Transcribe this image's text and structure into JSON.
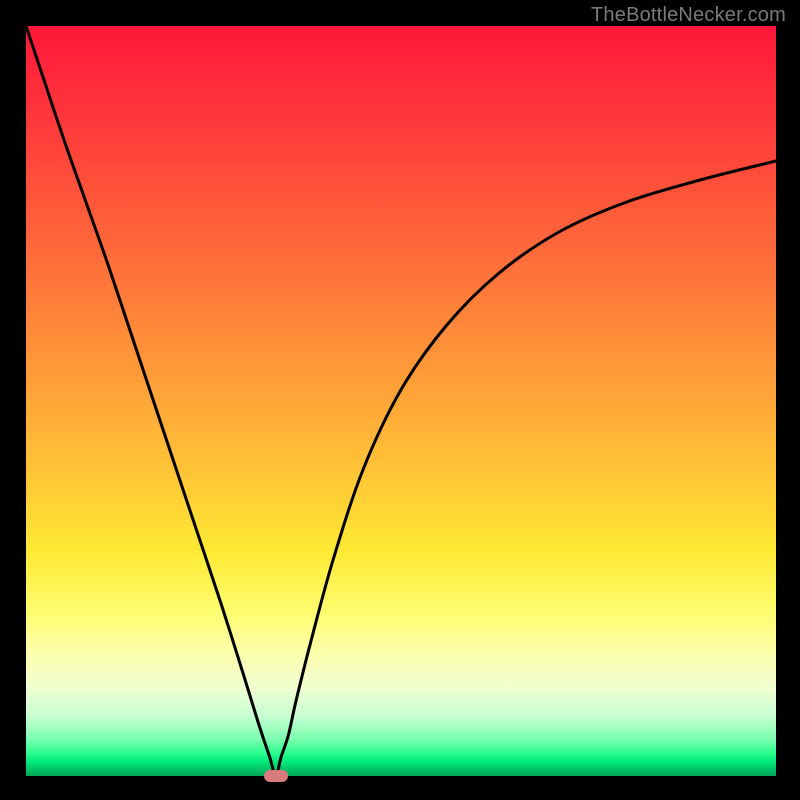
{
  "watermark": {
    "text": "TheBottleNecker.com"
  },
  "chart_data": {
    "type": "line",
    "title": "",
    "xlabel": "",
    "ylabel": "",
    "xlim": [
      0,
      100
    ],
    "ylim": [
      0,
      100
    ],
    "background_gradient": {
      "orientation": "vertical",
      "stops": [
        {
          "pos": 0,
          "color": "#ff173a"
        },
        {
          "pos": 0.14,
          "color": "#ff3c3b"
        },
        {
          "pos": 0.3,
          "color": "#ff6a3a"
        },
        {
          "pos": 0.46,
          "color": "#ff9a38"
        },
        {
          "pos": 0.6,
          "color": "#ffc636"
        },
        {
          "pos": 0.7,
          "color": "#ffe934"
        },
        {
          "pos": 0.78,
          "color": "#fffc6e"
        },
        {
          "pos": 0.84,
          "color": "#fcffb0"
        },
        {
          "pos": 0.88,
          "color": "#f2ffd0"
        },
        {
          "pos": 0.92,
          "color": "#c8ffd2"
        },
        {
          "pos": 0.95,
          "color": "#7dffb0"
        },
        {
          "pos": 0.97,
          "color": "#2bfc8d"
        },
        {
          "pos": 0.982,
          "color": "#00e67a"
        },
        {
          "pos": 0.99,
          "color": "#00c86a"
        },
        {
          "pos": 1.0,
          "color": "#00a858"
        }
      ]
    },
    "series": [
      {
        "name": "bottleneck-curve",
        "x": [
          0,
          2,
          5,
          8,
          11,
          14,
          17,
          20,
          23,
          26,
          29,
          31,
          32.5,
          33.3,
          34,
          35,
          36,
          38,
          41,
          45,
          50,
          56,
          63,
          71,
          80,
          90,
          100
        ],
        "y": [
          100,
          94,
          85,
          76.5,
          68,
          59,
          50,
          41,
          32,
          23,
          13.5,
          7,
          2.5,
          0,
          2.5,
          5.5,
          10,
          18,
          29,
          41,
          51.5,
          60,
          67,
          72.5,
          76.5,
          79.5,
          82
        ]
      }
    ],
    "marker": {
      "x": 33.3,
      "y": 0,
      "color": "#d97a7d"
    }
  }
}
